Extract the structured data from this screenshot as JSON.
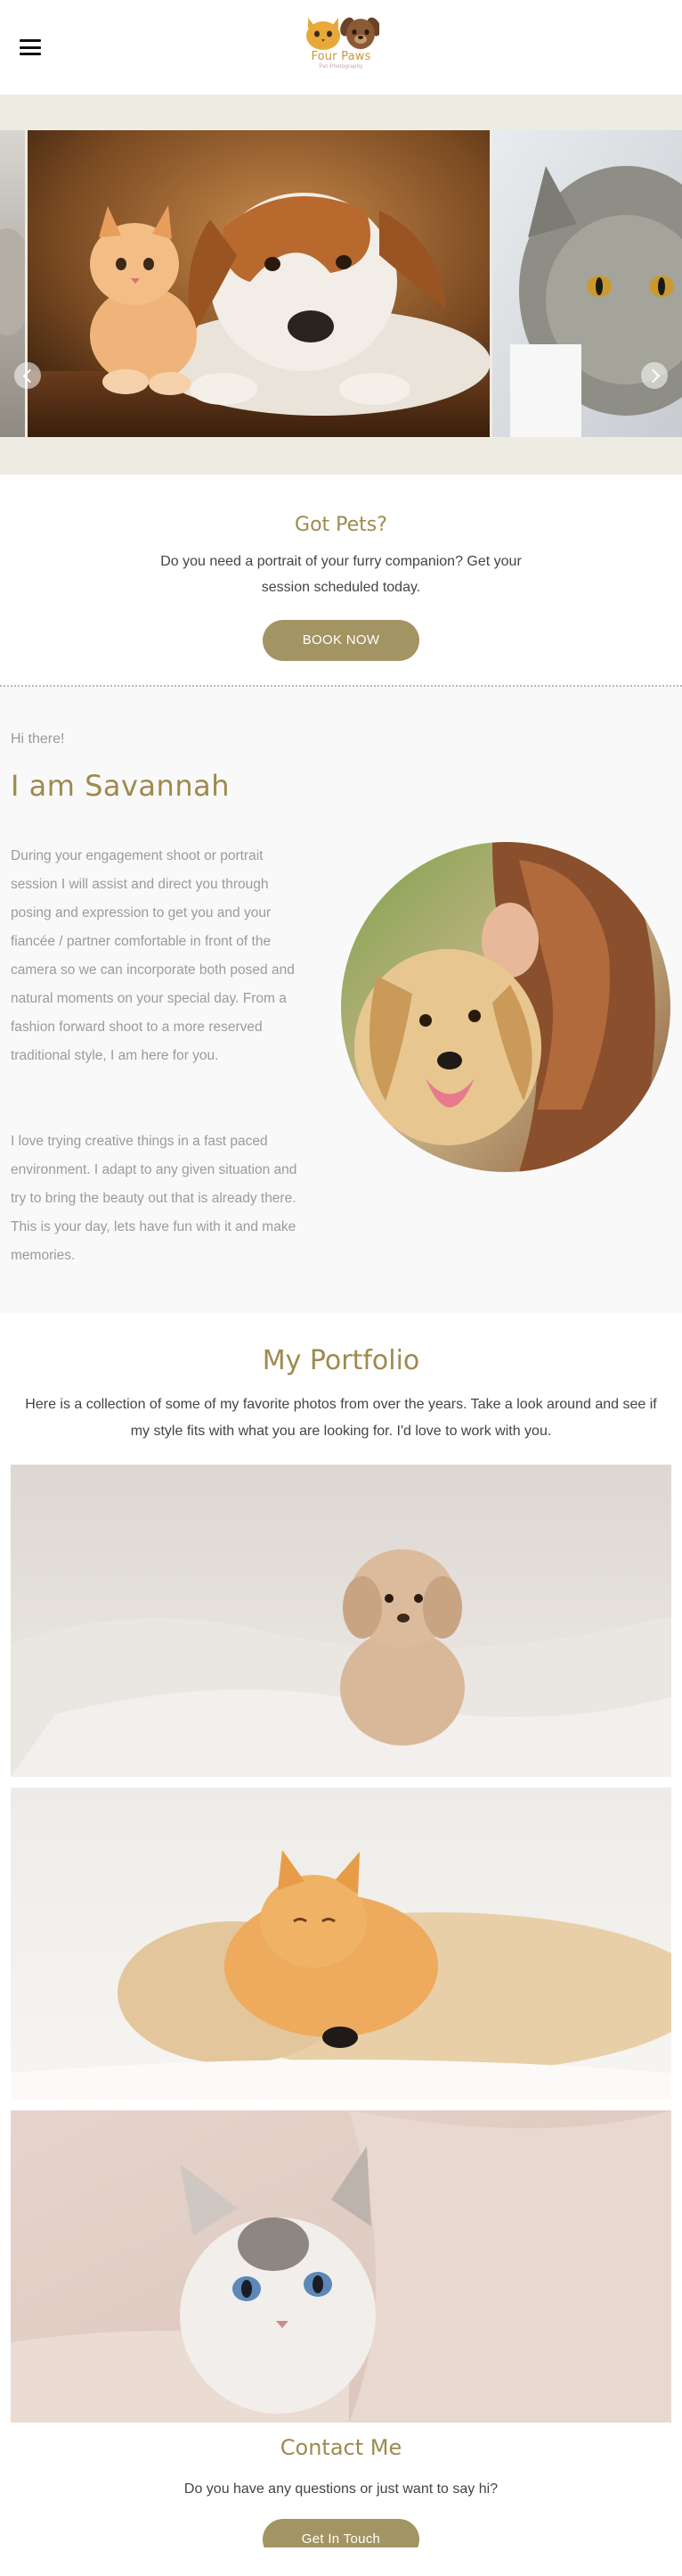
{
  "header": {
    "menu_icon": "hamburger-menu-icon",
    "logo": {
      "name": "Four Paws",
      "subtitle": "Pet Photography"
    }
  },
  "carousel": {
    "slides": [
      {
        "description": "cat-partial"
      },
      {
        "description": "kitten-and-dog"
      },
      {
        "description": "grey-cat"
      }
    ],
    "active_index": 1,
    "prev_icon": "chevron-left-icon",
    "next_icon": "chevron-right-icon"
  },
  "got_pets": {
    "title": "Got Pets?",
    "text": "Do you need a portrait of your furry companion? Get your session scheduled today.",
    "button": "BOOK NOW"
  },
  "about": {
    "greeting": "Hi there!",
    "name": "I am Savannah",
    "paragraph_1": "During your engagement shoot or portrait session I will assist and direct you through posing and expression to get you and your fiancée / partner comfortable in front of the camera so we can incorporate both posed and natural moments on your special day. From a fashion forward shoot to a more reserved traditional style, I am here for you.",
    "paragraph_2": "I love trying creative things in a fast paced environment. I adapt to any given situation and try to bring the beauty out that is already there. This is your day, lets have fun with it and make memories."
  },
  "portfolio": {
    "title": "My Portfolio",
    "text": "Here is a collection of some of my favorite photos from over the years. Take a look around and see if my style fits with what you are looking for. I'd love to work with you."
  },
  "contact": {
    "title": "Contact Me",
    "text": "Do you have any questions or just want to say hi?",
    "button": "Get In Touch"
  },
  "colors": {
    "accent": "#a39463",
    "heading": "#9e8a4e",
    "carousel_bg": "#eeebe3",
    "about_bg": "#f9f9f9"
  }
}
